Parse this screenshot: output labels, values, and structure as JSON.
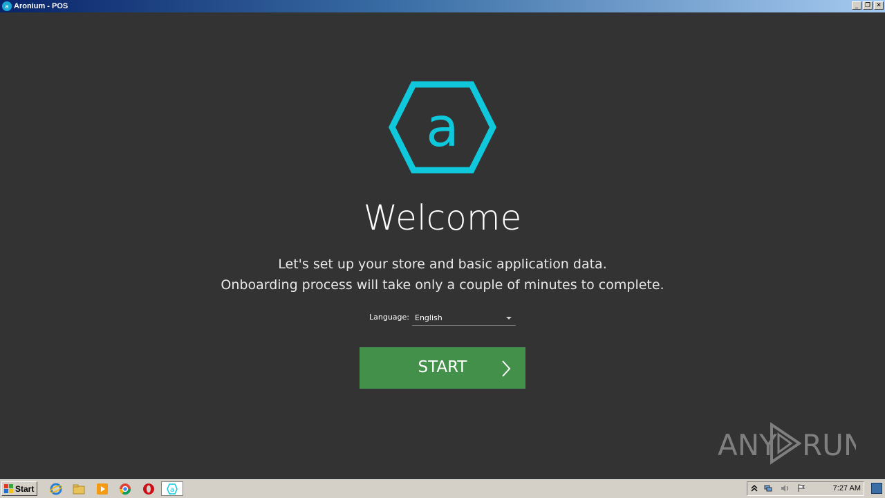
{
  "window": {
    "title": "Aronium - POS",
    "controls": {
      "minimize": "_",
      "restore": "❐",
      "close": "✕"
    }
  },
  "main": {
    "logo_letter": "a",
    "accent_color": "#0fc8dc",
    "heading": "Welcome",
    "intro_line1": "Let's set up your store and basic application data.",
    "intro_line2": "Onboarding process will take only a couple of minutes to complete.",
    "language": {
      "label": "Language:",
      "value": "English"
    },
    "start_button": {
      "label": "START",
      "color": "#43904a"
    }
  },
  "watermark": {
    "text_left": "ANY",
    "text_right": "RUN"
  },
  "taskbar": {
    "start_label": "Start",
    "clock": "7:27 AM",
    "quick_launch": [
      "internet-explorer-icon",
      "folder-icon",
      "media-player-icon",
      "chrome-icon",
      "opera-icon",
      "aronium-icon"
    ]
  }
}
